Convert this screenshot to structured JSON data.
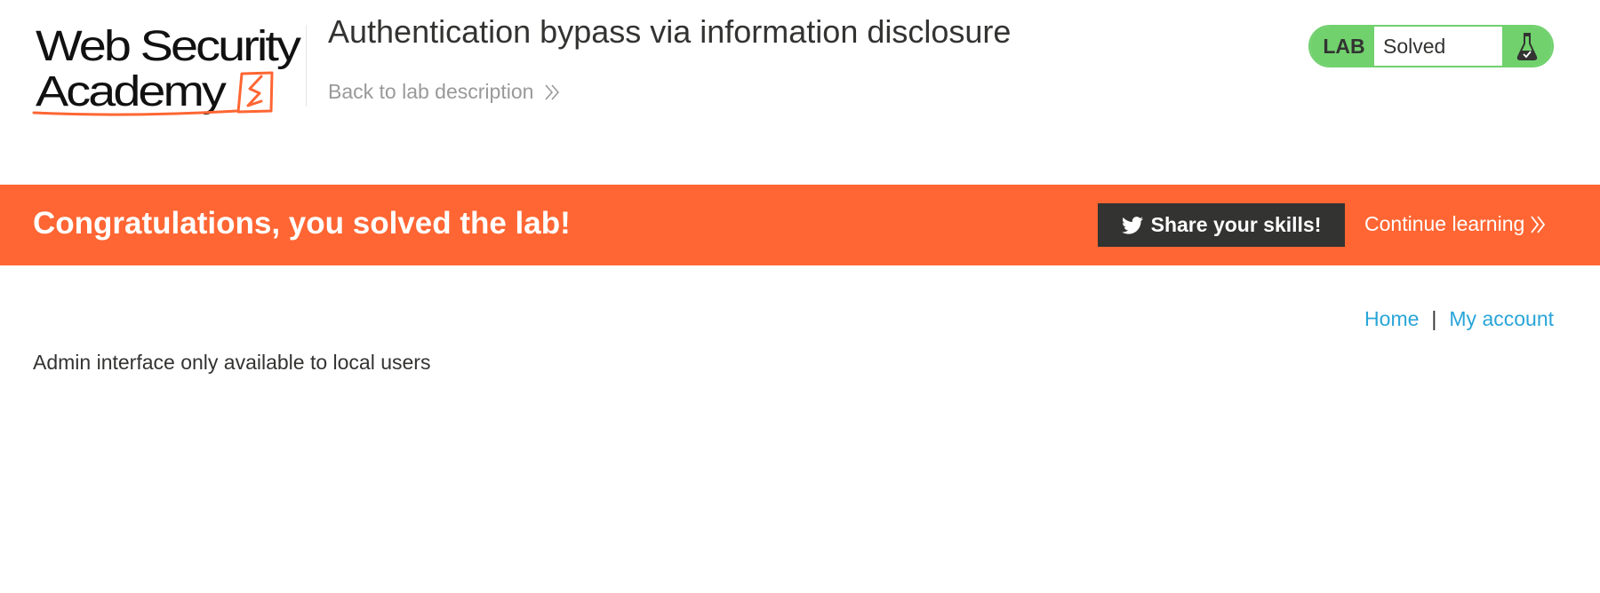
{
  "logo": {
    "line1": "Web Security",
    "line2": "Academy"
  },
  "lab": {
    "title": "Authentication bypass via information disclosure",
    "back_link_label": "Back to lab description",
    "status_label": "LAB",
    "status_value": "Solved"
  },
  "banner": {
    "message": "Congratulations, you solved the lab!",
    "share_label": "Share your skills!",
    "continue_label": "Continue learning"
  },
  "nav": {
    "home_label": "Home",
    "separator": "|",
    "account_label": "My account"
  },
  "main": {
    "message": "Admin interface only available to local users"
  },
  "colors": {
    "brand_orange": "#ff6633",
    "solved_green": "#70d16d",
    "link_blue": "#29a5d8",
    "dark": "#333332"
  },
  "icons": [
    "logo-flash-icon",
    "double-chevron-icon",
    "flask-icon",
    "twitter-icon"
  ]
}
